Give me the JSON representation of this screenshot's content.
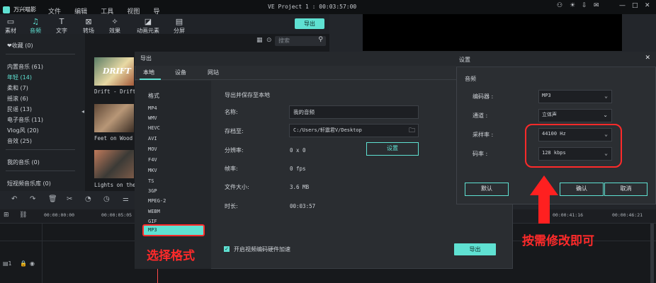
{
  "titlebar": {
    "app_name": "万兴喵影",
    "menu": [
      "文件",
      "编辑",
      "工具",
      "视图",
      "导出",
      "帮助"
    ],
    "project_title": "VE Project 1 : 00:03:57:00"
  },
  "toolbar": {
    "tabs": [
      {
        "label": "素材",
        "icon": "folder-icon"
      },
      {
        "label": "音频",
        "icon": "music-note-icon"
      },
      {
        "label": "文字",
        "icon": "text-icon"
      },
      {
        "label": "转场",
        "icon": "transition-icon"
      },
      {
        "label": "效果",
        "icon": "effects-icon"
      },
      {
        "label": "动画元素",
        "icon": "elements-icon"
      },
      {
        "label": "分屏",
        "icon": "split-screen-icon"
      }
    ],
    "export_label": "导出"
  },
  "sidebar": {
    "favorites": "❤收藏 (0)",
    "items": [
      "内置音乐 (61)",
      "年轻 (14)",
      "柔和 (7)",
      "摇滚 (6)",
      "民谣 (13)",
      "电子音乐 (11)",
      "Vlog风 (20)",
      "音效 (25)"
    ],
    "my_audio": "我的音乐 (0)",
    "short_video": "短视频音乐库 (0)"
  },
  "media": {
    "search_placeholder": "搜索",
    "thumbs": [
      {
        "label": "Drift - Drift",
        "art": "DRIFT"
      },
      {
        "label": "Feet on Wood - W",
        "art": ""
      },
      {
        "label": "Lights on the G",
        "art": ""
      }
    ]
  },
  "timeline": {
    "timecodes": [
      "00:00:00:00",
      "00:00:05:05",
      "00:00:41:16",
      "00:00:46:21"
    ]
  },
  "export_dialog": {
    "title": "导出",
    "tabs": [
      "本地",
      "设备",
      "网站"
    ],
    "format_heading": "格式",
    "formats": [
      "MP4",
      "WMV",
      "HEVC",
      "AVI",
      "MOV",
      "F4V",
      "MKV",
      "TS",
      "3GP",
      "MPEG-2",
      "WEBM",
      "GIF",
      "MP3"
    ],
    "selected_format": "MP3",
    "section_title": "导出并保存至本地",
    "name_label": "名称:",
    "name_value": "我的音频",
    "save_label": "存档至:",
    "save_value": "C:/Users/轩震君V/Desktop",
    "resolution_label": "分辨率:",
    "resolution_value": "0 x 0",
    "settings_button": "设置",
    "fps_label": "帧率:",
    "fps_value": "0 fps",
    "size_label": "文件大小:",
    "size_value": "3.6 MB",
    "duration_label": "时长:",
    "duration_value": "00:03:57",
    "hw_accel_label": "开启视频编码硬件加速",
    "hw_accel_checked": true,
    "export_button": "导出"
  },
  "settings_dialog": {
    "title": "设置",
    "section": "音频",
    "encoder_label": "编码器 :",
    "encoder_value": "MP3",
    "channel_label": "通道 :",
    "channel_value": "立体声",
    "samplerate_label": "采样率 :",
    "samplerate_value": "44100 Hz",
    "bitrate_label": "码率 :",
    "bitrate_value": "128 kbps",
    "default_button": "默认",
    "ok_button": "确认",
    "cancel_button": "取消"
  },
  "annotations": {
    "choose_format": "选择格式",
    "modify_hint": "按需修改即可"
  },
  "colors": {
    "accent": "#5fe1d2",
    "annotation": "#ff2a2a"
  }
}
